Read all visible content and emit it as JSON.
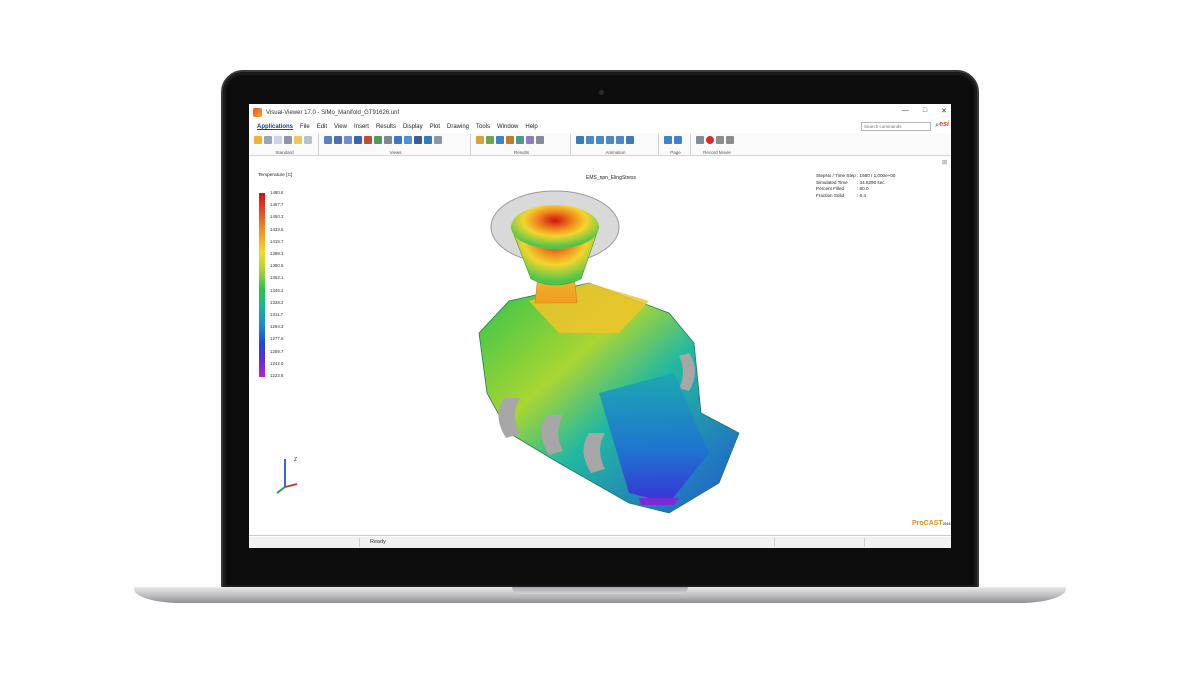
{
  "window": {
    "title": "Visual-Viewer 17.0 - SiMo_Manifold_GT91626.unf",
    "controls": [
      "—",
      "□",
      "✕"
    ]
  },
  "menu": {
    "items": [
      "Applications",
      "File",
      "Edit",
      "View",
      "Insert",
      "Results",
      "Display",
      "Plot",
      "Drawing",
      "Tools",
      "Window",
      "Help"
    ],
    "search_placeholder": "Search commands",
    "brand": "esi"
  },
  "toolbar": {
    "groups": [
      "Standard",
      "Views",
      "Results",
      "Animation",
      "Page",
      "Record Movie"
    ]
  },
  "viewport": {
    "result_name": "EMS_npn_ElingStress",
    "legend": {
      "title": "Temperature [C]",
      "ticks": [
        "1480.6",
        "1467.7",
        "1450.3",
        "1433.6",
        "1415.7",
        "1398.3",
        "1380.6",
        "1363.1",
        "1345.2",
        "1328.2",
        "1311.7",
        "1294.3",
        "1277.6",
        "1259.7",
        "1242.0",
        "1223.6"
      ]
    },
    "info": [
      {
        "label": "StepNo / Time Step",
        "value": ": 1660 / 1.000e+00"
      },
      {
        "label": "Simulated Time",
        "value": ": 34.6290 sec"
      },
      {
        "label": "Percent Filled",
        "value": ": 80.0"
      },
      {
        "label": "Fraction Solid",
        "value": ": 6.4"
      }
    ],
    "axis_label": "Z",
    "logo": "ProCAST",
    "logo_sup": "2016"
  },
  "status": {
    "text": "Ready"
  },
  "colors": {
    "hot": "#cf1412",
    "warm": "#f39a1c",
    "mid": "#2ec34a",
    "cool": "#1a8ad4",
    "cold": "#c11cd6",
    "brand": "#e4402e"
  }
}
